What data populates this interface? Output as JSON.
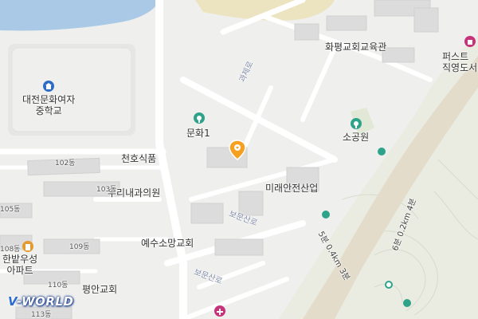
{
  "map": {
    "labels": {
      "daejeon_school": "대전문화여자\n중학교",
      "hwapyeong": "화평교회교육관",
      "first_library": "퍼스트\n직영도서",
      "munhwa1": "문화1",
      "sogongwon": "소공원",
      "cheonho": "천호식품",
      "uri_clinic": "우리내과의원",
      "mirae": "미래안전산업",
      "hanbat_apt": "한밭우성\n아파트",
      "yesu_church": "예수소망교회",
      "pyeongan_church": "평안교회"
    },
    "buildings": {
      "b102": "102동",
      "b103": "103동",
      "b105": "105동",
      "b108": "108동",
      "b109": "109동",
      "b110": "110동",
      "b113": "113동"
    },
    "roads": {
      "gwajaero": "과제로",
      "bomunsanro_1": "보문산로",
      "bomunsanro_2": "보문산로"
    },
    "trails": {
      "trail_a": "5분 0.4km 3분",
      "trail_b": "6분 0.2km 4분"
    },
    "logo": {
      "prefix": "V",
      "suffix": "-WORLD"
    },
    "colors": {
      "water": "#a9c9e6",
      "park": "#eae3c4",
      "building": "#dedede",
      "road": "#ffffff",
      "mountain": "#e9ece0",
      "hill_line": "#cfd6c8",
      "poi_green": "#2ea38a",
      "poi_blue": "#2d6bc4",
      "poi_pink": "#c6337b",
      "poi_orange": "#e49a2e",
      "pin": "#f5a020"
    },
    "icons": [
      "school-icon",
      "park-icon",
      "library-icon",
      "hospital-icon",
      "trail-marker-icon",
      "location-pin-icon"
    ]
  }
}
